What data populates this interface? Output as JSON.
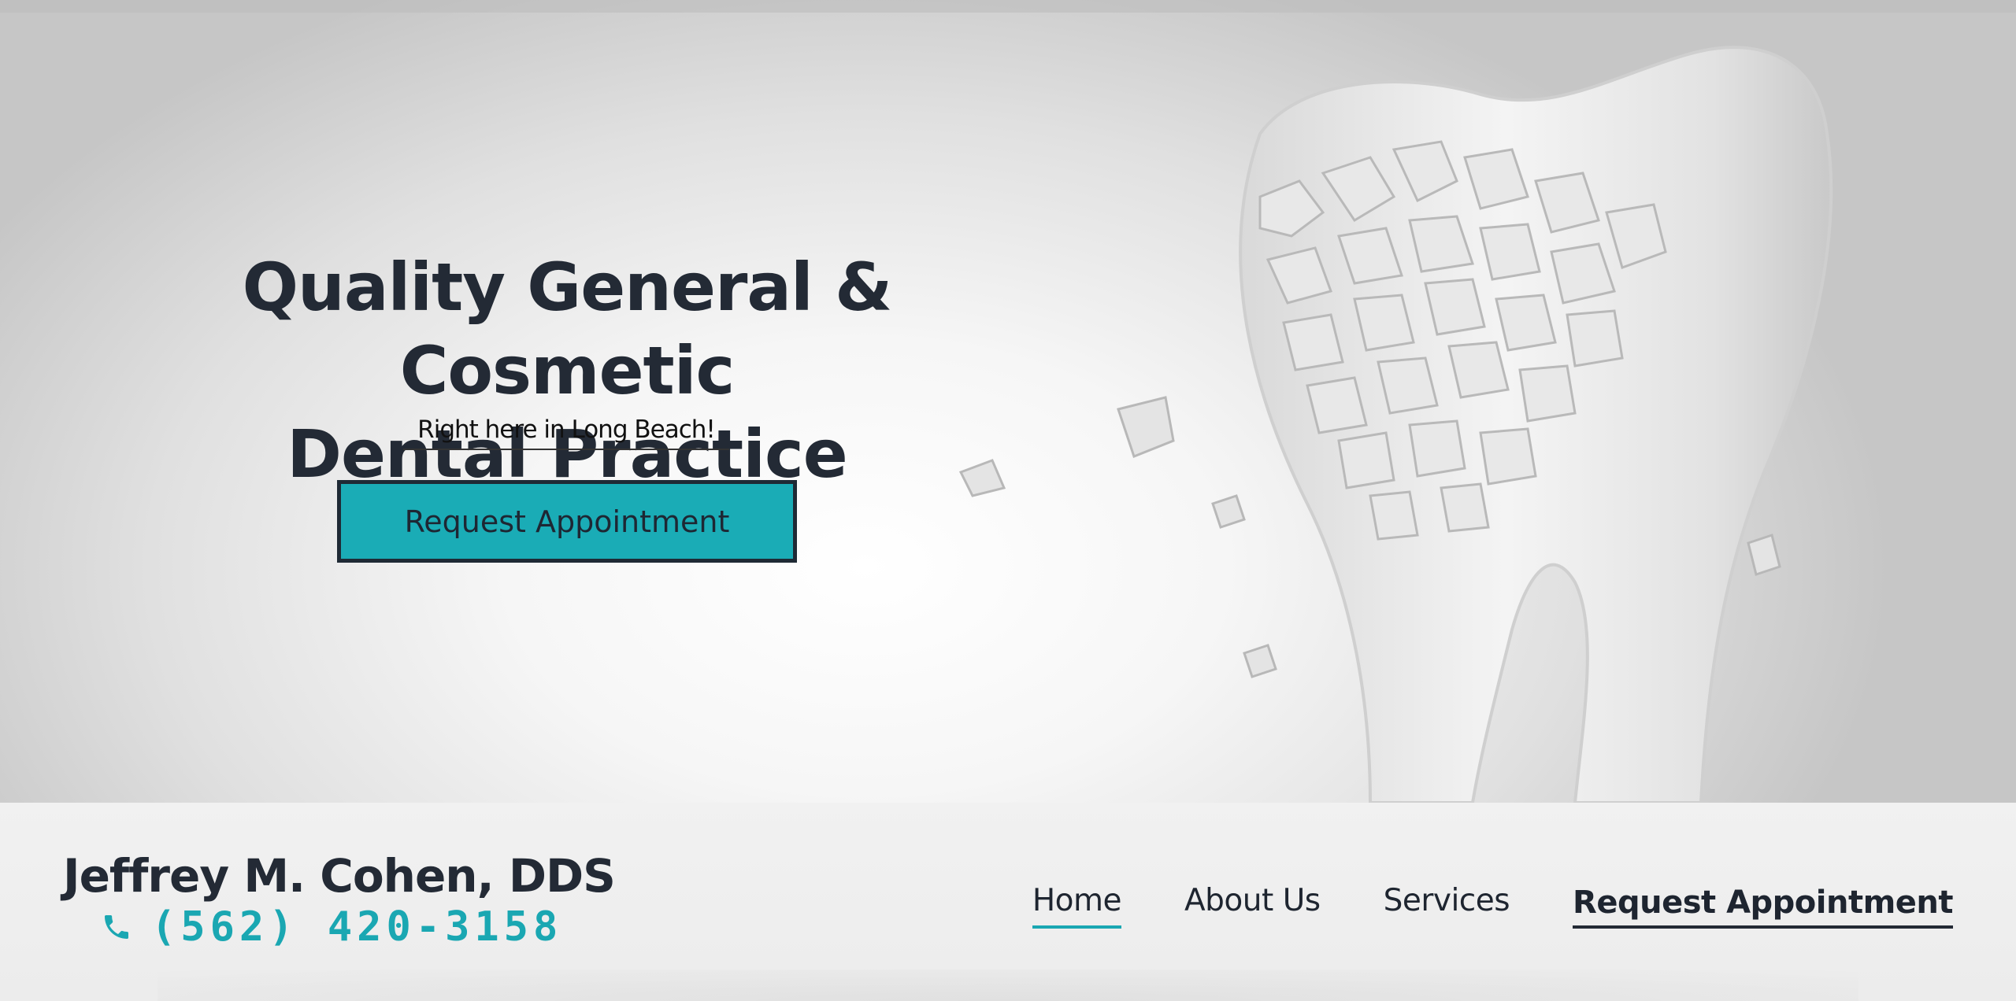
{
  "hero": {
    "headline_line1": "Quality General & Cosmetic",
    "headline_line2": "Dental Practice",
    "subtitle": "Right here in Long Beach!",
    "cta_label": "Request Appointment",
    "image_icon": "shattered-tooth-illustration"
  },
  "header": {
    "brand_name": "Jeffrey M. Cohen, DDS",
    "phone": "(562) 420-3158",
    "phone_icon": "phone-icon"
  },
  "nav": {
    "items": [
      {
        "label": "Home",
        "active": true
      },
      {
        "label": "About Us",
        "active": false
      },
      {
        "label": "Services",
        "active": false
      },
      {
        "label": "Request Appointment",
        "active": false
      }
    ]
  },
  "colors": {
    "accent": "#1aacb6",
    "text_dark": "#232a35",
    "header_bg": "#efefef"
  }
}
